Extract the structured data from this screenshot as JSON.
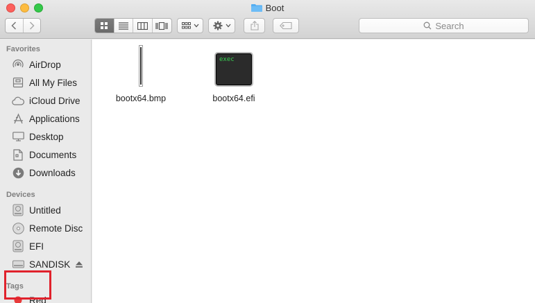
{
  "window": {
    "title": "Boot"
  },
  "toolbar": {
    "search_placeholder": "Search",
    "view_modes": [
      "icon",
      "list",
      "column",
      "cover-flow"
    ]
  },
  "sidebar": {
    "favorites_header": "Favorites",
    "favorites": [
      {
        "label": "AirDrop",
        "icon": "airdrop-icon"
      },
      {
        "label": "All My Files",
        "icon": "all-files-icon"
      },
      {
        "label": "iCloud Drive",
        "icon": "cloud-icon"
      },
      {
        "label": "Applications",
        "icon": "applications-icon"
      },
      {
        "label": "Desktop",
        "icon": "desktop-icon"
      },
      {
        "label": "Documents",
        "icon": "documents-icon"
      },
      {
        "label": "Downloads",
        "icon": "downloads-icon"
      }
    ],
    "devices_header": "Devices",
    "devices": [
      {
        "label": "Untitled",
        "icon": "disk-icon"
      },
      {
        "label": "Remote Disc",
        "icon": "disc-icon"
      },
      {
        "label": "EFI",
        "icon": "disk-icon"
      },
      {
        "label": "SANDISK",
        "icon": "external-disk-icon"
      }
    ],
    "tags_header": "Tags",
    "tags": [
      {
        "label": "Red",
        "color": "#e83a3a"
      }
    ]
  },
  "files": [
    {
      "name": "bootx64.bmp",
      "kind": "image"
    },
    {
      "name": "bootx64.efi",
      "kind": "executable",
      "badge": "exec"
    }
  ],
  "colors": {
    "highlight": "#e0222c",
    "folder": "#54aef2"
  }
}
